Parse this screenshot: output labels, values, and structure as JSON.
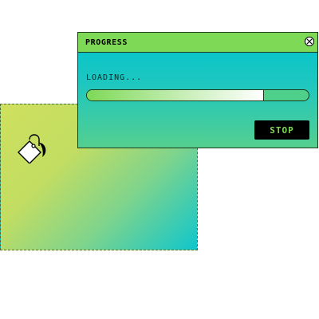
{
  "dialog": {
    "title": "PROGRESS",
    "close_icon": "close-icon",
    "status_text": "LOADING...",
    "progress_fraction": 0.8,
    "stop_label": "STOP"
  },
  "canvas": {
    "icon": "paint-bucket-icon"
  },
  "colors": {
    "titlebar": "#7ed957",
    "dialog_gradient_top": "#00c3cf",
    "dialog_gradient_bottom": "#55cf8f",
    "canvas_gradient_start": "#cfe05e",
    "canvas_gradient_end": "#0fc6cc",
    "stop_button_bg": "#000000",
    "stop_button_text": "#7ed957"
  }
}
